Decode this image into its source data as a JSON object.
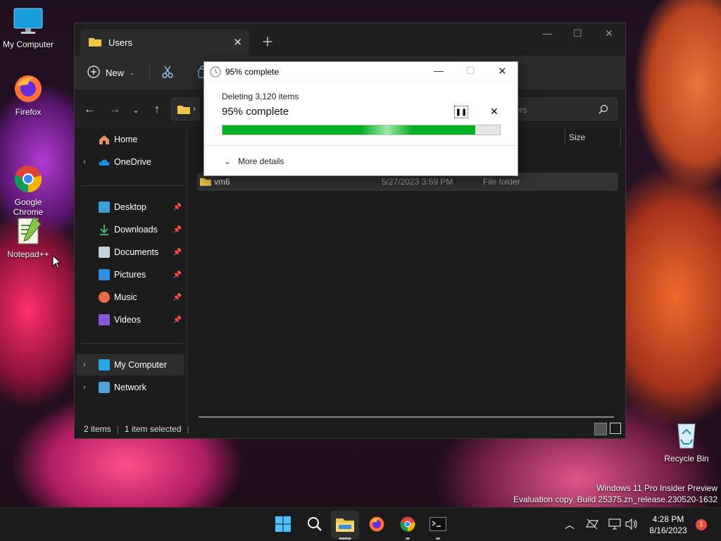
{
  "desktop": {
    "icons": [
      {
        "label": "My Computer"
      },
      {
        "label": "Firefox"
      },
      {
        "label": "Google\nChrome"
      },
      {
        "label": "Notepad++"
      },
      {
        "label": "Recycle Bin"
      }
    ]
  },
  "explorer": {
    "tab_title": "Users",
    "toolbar": {
      "new_label": "New"
    },
    "search_placeholder": "ers",
    "nav": {
      "home": "Home",
      "onedrive": "OneDrive",
      "desktop": "Desktop",
      "downloads": "Downloads",
      "documents": "Documents",
      "pictures": "Pictures",
      "music": "Music",
      "videos": "Videos",
      "my_computer": "My Computer",
      "network": "Network"
    },
    "columns": {
      "size": "Size"
    },
    "rows": [
      {
        "name": "vm6",
        "date": "5/27/2023 3:59 PM",
        "type": "File folder"
      }
    ],
    "status": {
      "items": "2 items",
      "selected": "1 item selected"
    }
  },
  "dialog": {
    "title": "95% complete",
    "operation": "Deleting 3,120 items",
    "percent_text": "95% complete",
    "progress": 0.91,
    "more_details": "More details"
  },
  "taskbar": {
    "time": "4:28 PM",
    "date": "8/16/2023",
    "notification_count": "1"
  },
  "watermark": {
    "line1": "Windows 11 Pro Insider Preview",
    "line2": "Evaluation copy. Build 25375.zn_release.230520-1632"
  },
  "colors": {
    "progress_fill": "#06b025",
    "explorer_bg": "#1c1c1c",
    "taskbar_bg": "#1b1b1b",
    "notification_badge": "#e74c3c"
  }
}
